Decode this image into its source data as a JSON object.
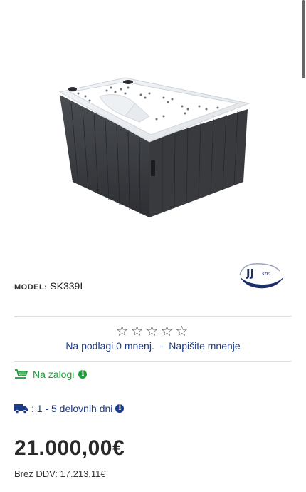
{
  "product": {
    "model_label": "MODEL:",
    "model_value": "SK339I",
    "brand_logo_text": "JJ",
    "brand_logo_sub": "spa"
  },
  "rating": {
    "stars": "☆☆☆☆☆",
    "reviews_text": "Na podlagi 0 mnenj.",
    "separator": "-",
    "write_review": "Napišite mnenje"
  },
  "availability": {
    "stock_text": "Na zalogi",
    "delivery_text": ": 1 - 5 delovnih dni"
  },
  "pricing": {
    "price": "21.000,00€",
    "net_label": "Brez DDV:",
    "net_value": "17.213,11€"
  },
  "colors": {
    "green": "#1f9d3a",
    "blue": "#1b3a8a"
  }
}
